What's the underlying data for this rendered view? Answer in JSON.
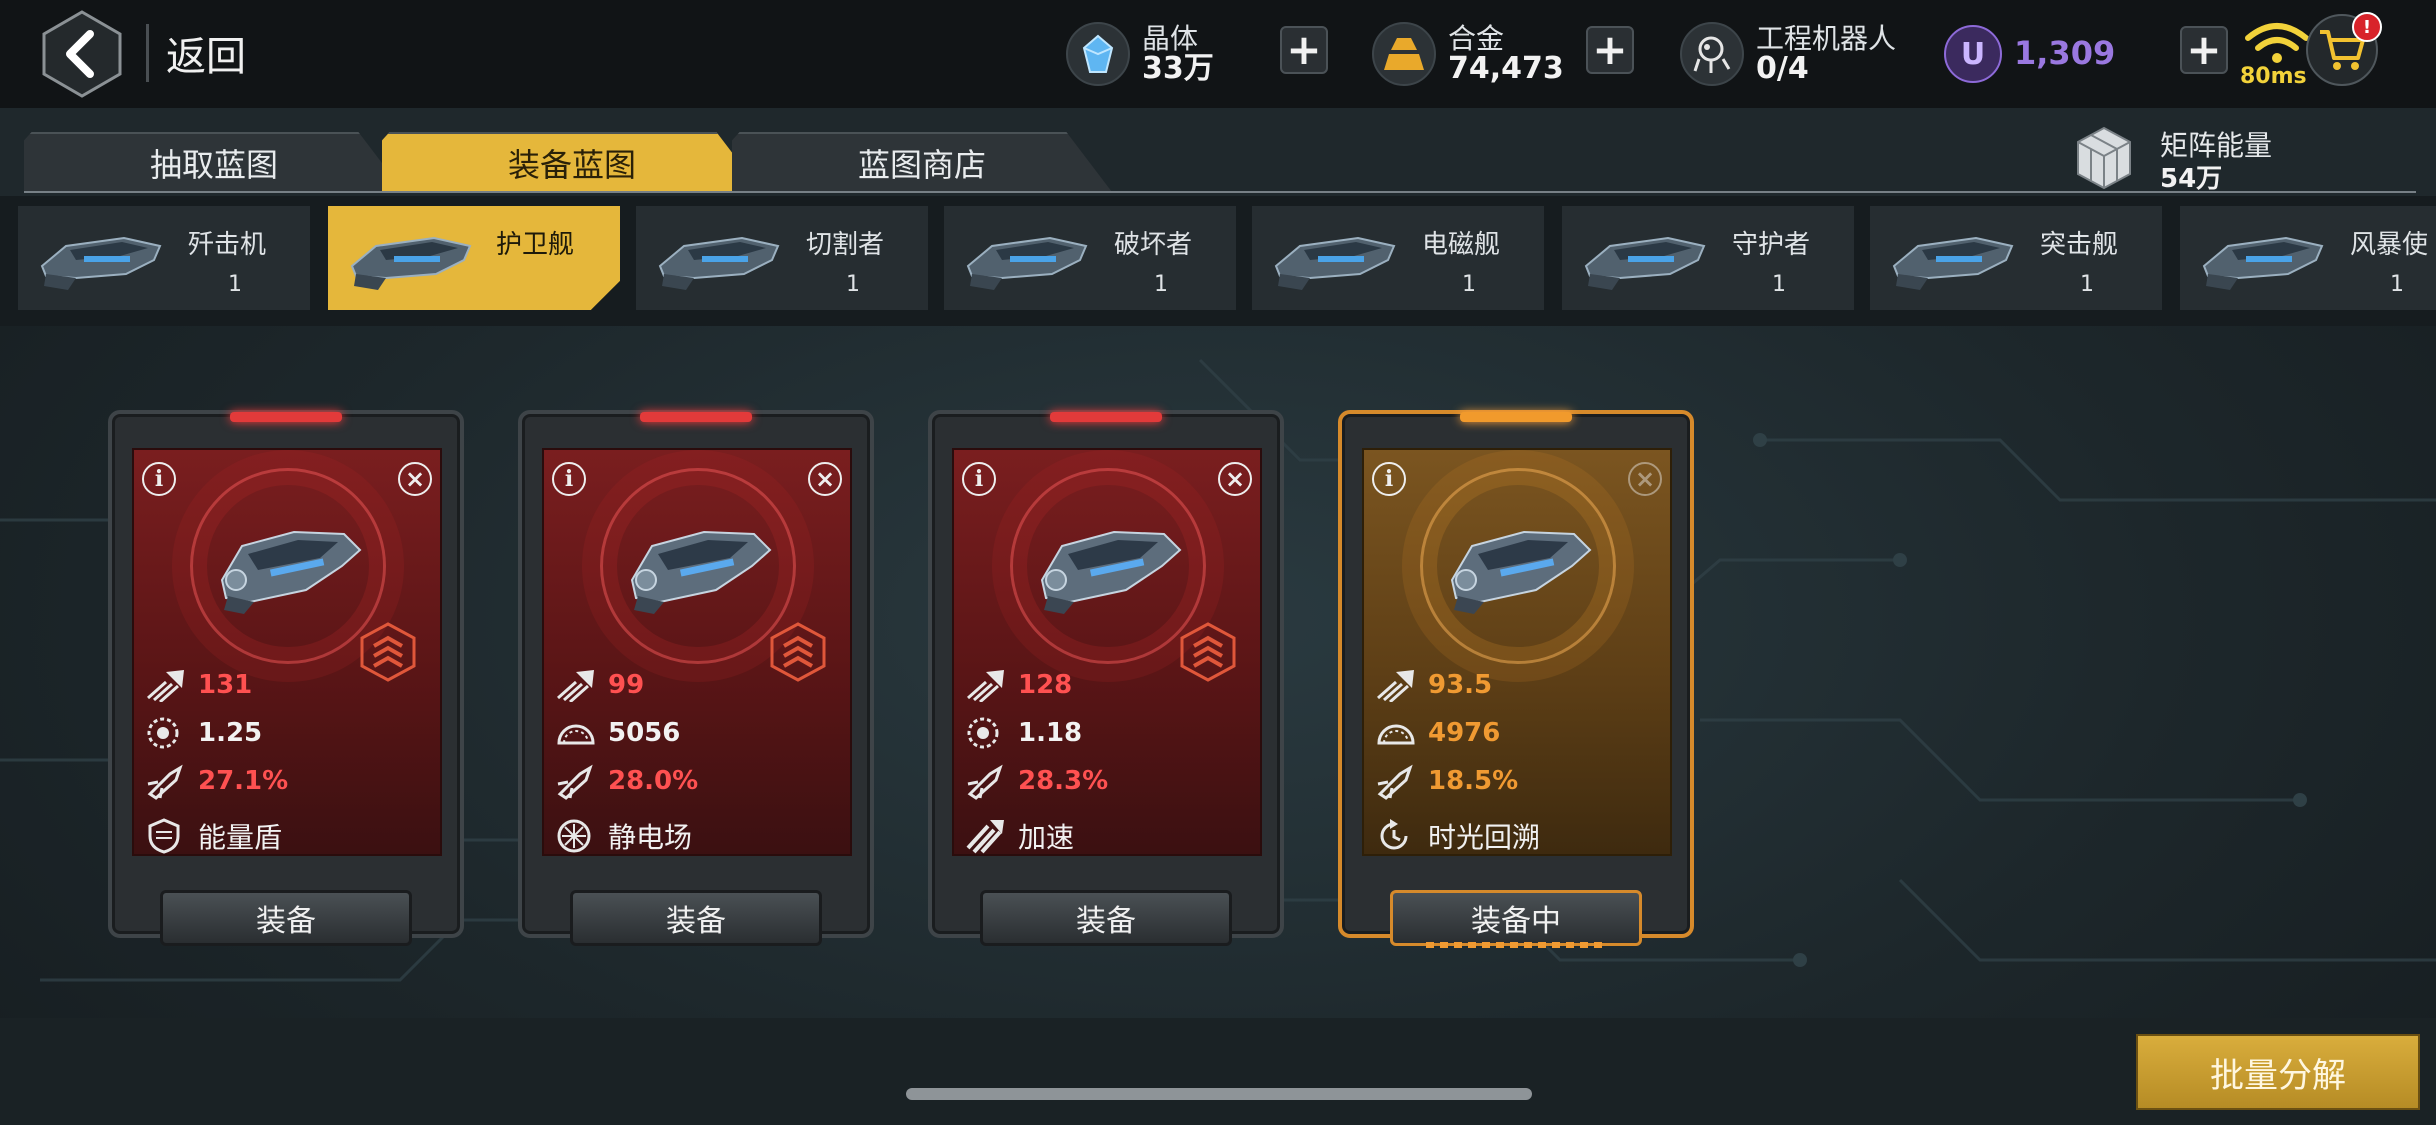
{
  "header": {
    "back_label": "返回",
    "resources": [
      {
        "name": "晶体",
        "value": "33万",
        "icon": "crystal-icon"
      },
      {
        "name": "合金",
        "value": "74,473",
        "icon": "alloy-icon"
      },
      {
        "name": "工程机器人",
        "value": "0/4",
        "icon": "robot-icon"
      }
    ],
    "u_currency": {
      "symbol": "U",
      "value": "1,309",
      "color": "#9a78e0"
    },
    "ping": "80ms",
    "cart_badge": "!"
  },
  "tabs": [
    {
      "label": "抽取蓝图",
      "active": false
    },
    {
      "label": "装备蓝图",
      "active": true
    },
    {
      "label": "蓝图商店",
      "active": false
    }
  ],
  "matrix_energy": {
    "name": "矩阵能量",
    "value": "54万"
  },
  "ships": [
    {
      "name": "歼击机",
      "count": "1",
      "active": false
    },
    {
      "name": "护卫舰",
      "count": "",
      "active": true
    },
    {
      "name": "切割者",
      "count": "1",
      "active": false
    },
    {
      "name": "破坏者",
      "count": "1",
      "active": false
    },
    {
      "name": "电磁舰",
      "count": "1",
      "active": false
    },
    {
      "name": "守护者",
      "count": "1",
      "active": false
    },
    {
      "name": "突击舰",
      "count": "1",
      "active": false
    },
    {
      "name": "风暴使",
      "count": "1",
      "active": false
    }
  ],
  "cards": [
    {
      "attack": "131",
      "stat2": "1.25",
      "stat2_icon": "rate-icon",
      "crit": "27.1%",
      "skill": "能量盾",
      "skill_icon": "shield-icon",
      "button": "装备",
      "equipped": false
    },
    {
      "attack": "99",
      "stat2": "5056",
      "stat2_icon": "durability-icon",
      "crit": "28.0%",
      "skill": "静电场",
      "skill_icon": "static-field-icon",
      "button": "装备",
      "equipped": false
    },
    {
      "attack": "128",
      "stat2": "1.18",
      "stat2_icon": "rate-icon",
      "crit": "28.3%",
      "skill": "加速",
      "skill_icon": "boost-icon",
      "button": "装备",
      "equipped": false
    },
    {
      "attack": "93.5",
      "stat2": "4976",
      "stat2_icon": "durability-icon",
      "crit": "18.5%",
      "skill": "时光回溯",
      "skill_icon": "time-rewind-icon",
      "button": "装备中",
      "equipped": true
    }
  ],
  "batch_button": "批量分解",
  "colors": {
    "accent": "#e5b73b",
    "red": "#ff5151",
    "orange": "#f09a32"
  }
}
